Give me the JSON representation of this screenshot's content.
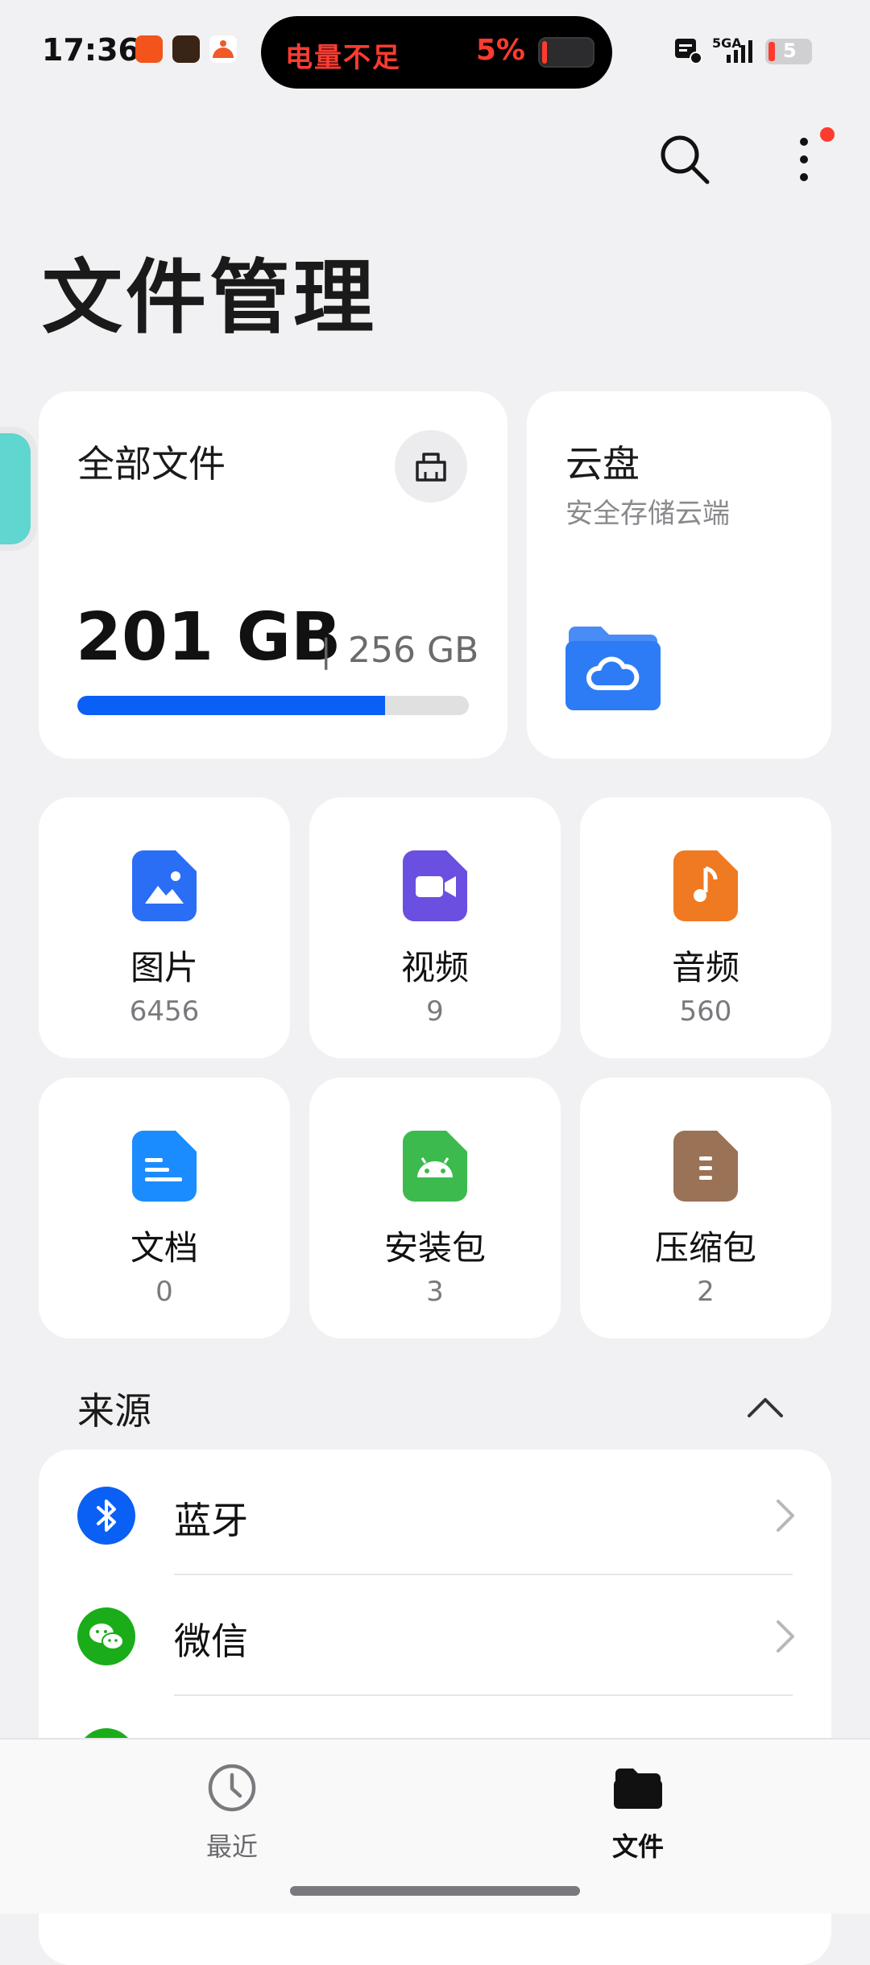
{
  "status_bar": {
    "time": "17:36",
    "alert_text": "电量不足",
    "alert_percent": "5%",
    "network": "5GA",
    "battery_level": "5",
    "colors": {
      "alert": "#ff3b30"
    }
  },
  "header": {
    "title": "文件管理",
    "search_icon": "search-icon",
    "more_icon": "more-vertical-icon"
  },
  "storage": {
    "label": "全部文件",
    "used": "201 GB",
    "separator": "|",
    "total": "256 GB",
    "used_fraction": 0.785,
    "clean_icon": "broom-icon",
    "accent": "#0a60f5"
  },
  "cloud": {
    "title": "云盘",
    "subtitle": "安全存储云端",
    "icon": "cloud-folder-icon"
  },
  "categories": [
    {
      "label": "图片",
      "count": "6456",
      "icon": "image-icon",
      "color": "#2a6ef5"
    },
    {
      "label": "视频",
      "count": "9",
      "icon": "video-icon",
      "color": "#6a4fe0"
    },
    {
      "label": "音频",
      "count": "560",
      "icon": "music-icon",
      "color": "#f07a22"
    },
    {
      "label": "文档",
      "count": "0",
      "icon": "document-icon",
      "color": "#1a8cff"
    },
    {
      "label": "安装包",
      "count": "3",
      "icon": "android-icon",
      "color": "#3dba4e"
    },
    {
      "label": "压缩包",
      "count": "2",
      "icon": "archive-icon",
      "color": "#9a7255"
    }
  ],
  "sources": {
    "header": "来源",
    "items": [
      {
        "label": "蓝牙",
        "icon": "bluetooth-icon",
        "color": "#0a60f5"
      },
      {
        "label": "微信",
        "icon": "wechat-icon",
        "color": "#1aad19"
      }
    ]
  },
  "bottom_nav": {
    "items": [
      {
        "label": "最近",
        "icon": "clock-icon",
        "active": false
      },
      {
        "label": "文件",
        "icon": "folder-icon",
        "active": true
      }
    ]
  }
}
